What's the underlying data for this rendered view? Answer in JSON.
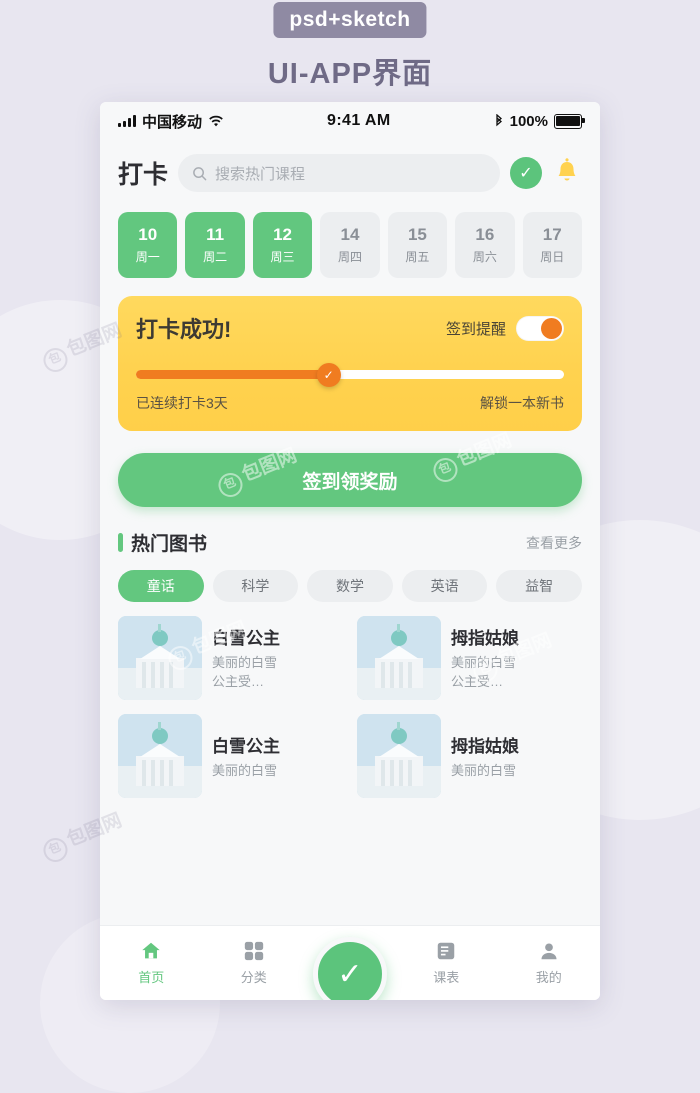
{
  "poster": {
    "badge": "psd+sketch",
    "title": "UI-APP界面",
    "watermarks": [
      "包图网",
      "包图网",
      "包图网",
      "包图网",
      "包图网",
      "包图网"
    ]
  },
  "statusbar": {
    "carrier": "中国移动",
    "time": "9:41 AM",
    "battery_percent": "100%",
    "icons": [
      "signal-icon",
      "wifi-icon",
      "bluetooth-icon",
      "battery-icon"
    ]
  },
  "topbar": {
    "app_title": "打卡",
    "search_placeholder": "搜索热门课程",
    "check_icon": "✓",
    "bell_icon": "bell-icon"
  },
  "week": [
    {
      "num": "10",
      "weekday": "周一",
      "active": true
    },
    {
      "num": "11",
      "weekday": "周二",
      "active": true
    },
    {
      "num": "12",
      "weekday": "周三",
      "active": true
    },
    {
      "num": "14",
      "weekday": "周四",
      "active": false
    },
    {
      "num": "15",
      "weekday": "周五",
      "active": false
    },
    {
      "num": "16",
      "weekday": "周六",
      "active": false
    },
    {
      "num": "17",
      "weekday": "周日",
      "active": false
    }
  ],
  "card": {
    "title": "打卡成功!",
    "remind_label": "签到提醒",
    "toggle_on": true,
    "progress_percent": 45,
    "knob_icon": "✓",
    "left_text": "已连续打卡3天",
    "right_text": "解锁一本新书"
  },
  "cta": {
    "label": "签到领奖励"
  },
  "section": {
    "title": "热门图书",
    "more": "查看更多"
  },
  "tags": [
    {
      "label": "童话",
      "active": true
    },
    {
      "label": "科学",
      "active": false
    },
    {
      "label": "数学",
      "active": false
    },
    {
      "label": "英语",
      "active": false
    },
    {
      "label": "益智",
      "active": false
    }
  ],
  "books": [
    {
      "title": "白雪公主",
      "desc": "美丽的白雪\n公主受…"
    },
    {
      "title": "拇指姑娘",
      "desc": "美丽的白雪\n公主受…"
    },
    {
      "title": "白雪公主",
      "desc": "美丽的白雪"
    },
    {
      "title": "拇指姑娘",
      "desc": "美丽的白雪"
    }
  ],
  "tabbar": {
    "items": [
      {
        "label": "首页",
        "icon": "home-icon",
        "active": true
      },
      {
        "label": "分类",
        "icon": "grid-icon",
        "active": false
      },
      {
        "label": "课表",
        "icon": "list-icon",
        "active": false
      },
      {
        "label": "我的",
        "icon": "user-icon",
        "active": false
      }
    ],
    "fab_icon": "✓"
  },
  "colors": {
    "green": "#63c77f",
    "yellow": "#ffd24f",
    "orange": "#f07c20",
    "bg": "#e8e6f0"
  }
}
